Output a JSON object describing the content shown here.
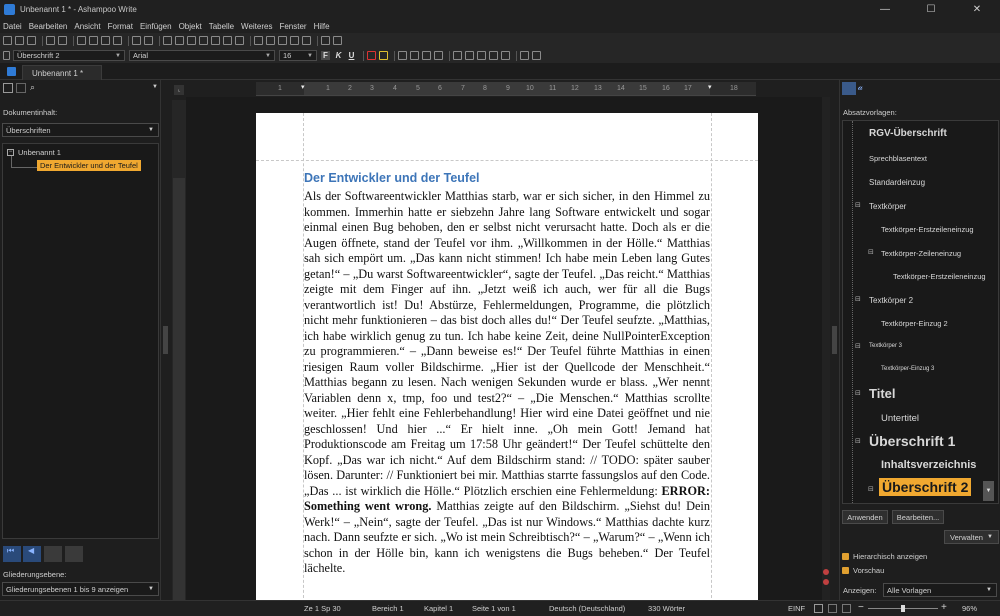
{
  "window": {
    "title": "Unbenannt 1 * - Ashampoo Write"
  },
  "menu": [
    "Datei",
    "Bearbeiten",
    "Ansicht",
    "Format",
    "Einfügen",
    "Objekt",
    "Tabelle",
    "Weiteres",
    "Fenster",
    "Hilfe"
  ],
  "format_toolbar": {
    "paragraph_style": "Überschrift 2",
    "font": "Arial",
    "font_size": "16",
    "bold": "F",
    "italic": "K",
    "underline": "U"
  },
  "tabs": {
    "document_tab": "Unbenannt 1 *"
  },
  "navigator": {
    "content_label": "Dokumentinhalt:",
    "content_select": "Überschriften",
    "tree_root": "Unbenannt 1",
    "tree_child": "Der Entwickler und der Teufel",
    "level_label": "Gliederungsebene:",
    "level_select": "Gliederungsebenen 1 bis 9 anzeigen"
  },
  "ruler": {
    "marks": [
      "1",
      "1",
      "2",
      "3",
      "4",
      "5",
      "6",
      "7",
      "8",
      "9",
      "10",
      "11",
      "12",
      "13",
      "14",
      "15",
      "16",
      "17",
      "18"
    ]
  },
  "document": {
    "heading": "Der Entwickler und der Teufel",
    "body_part1": "Als der Softwareentwickler Matthias starb, war er sich sicher, in den Himmel zu kommen. Immerhin hatte er siebzehn Jahre lang Software entwickelt und sogar einmal einen Bug behoben, den er selbst nicht verursacht hatte. Doch als er die Augen öffnete, stand der Teufel vor ihm. „Willkommen in der Hölle.“ Matthias sah sich empört um. „Das kann nicht stimmen! Ich habe mein Leben lang Gutes getan!“ – „Du warst Softwareentwickler“, sagte der Teufel. „Das reicht.“ Matthias zeigte mit dem Finger auf ihn. „Jetzt weiß ich auch, wer für all die Bugs verantwortlich ist! Du! Abstürze, Fehlermeldungen, Programme, die plötzlich nicht mehr funktionieren – das bist doch alles du!“ Der Teufel seufzte. „Matthias, ich habe wirklich genug zu tun. Ich habe keine Zeit, deine NullPointerException zu programmieren.“ – „Dann beweise es!“ Der Teufel führte Matthias in einen riesigen Raum voller Bildschirme. „Hier ist der Quellcode der Menschheit.“ Matthias begann zu lesen. Nach wenigen Sekunden wurde er blass. „Wer nennt Variablen denn x, tmp, foo und test2?“ – „Die Menschen.“ Matthias scrollte weiter. „Hier fehlt eine Fehlerbehandlung! Hier wird eine Datei geöffnet und nie geschlossen! Und hier ...“ Er hielt inne. „Oh mein Gott! Jemand hat Produktionscode am Freitag um 17:58 Uhr geändert!“ Der Teufel schüttelte den Kopf. „Das war ich nicht.“ Auf dem Bildschirm stand: // TODO: später sauber lösen. Darunter: // Funktioniert bei mir. Matthias starrte fassungslos auf den Code. „Das ... ist wirklich die Hölle.“ Plötzlich erschien eine Fehlermeldung: ",
    "body_bold": "ERROR: Something went wrong.",
    "body_part2": " Matthias zeigte auf den Bildschirm. „Siehst du! Dein Werk!“ – „Nein“, sagte der Teufel. „Das ist nur Windows.“ Matthias dachte kurz nach. Dann seufzte er sich. „Wo ist mein Schreibtisch?“ – „Warum?“ – „Wenn ich schon in der Hölle bin, kann ich wenigstens die Bugs beheben.“ Der Teufel lächelte."
  },
  "styles_panel": {
    "title": "Absatzvorlagen:",
    "items": [
      "RGV-Überschrift",
      "Sprechblasentext",
      "Standardeinzug",
      "Textkörper",
      "Textkörper-Erstzeileneinzug",
      "Textkörper-Zeileneinzug",
      "Textkörper-Erstzeileneinzug",
      "Textkörper 2",
      "Textkörper-Einzug 2",
      "Textkörper 3",
      "Textkörper-Einzug 3",
      "Titel",
      "Untertitel",
      "Überschrift 1",
      "Inhaltsverzeichnis",
      "Überschrift 2"
    ],
    "apply_button": "Anwenden",
    "edit_button": "Bearbeiten...",
    "manage_button": "Verwalten",
    "hierarchical_label": "Hierarchisch anzeigen",
    "preview_label": "Vorschau",
    "show_label": "Anzeigen:",
    "show_select": "Alle Vorlagen"
  },
  "status": {
    "position": "Ze 1 Sp 30",
    "area": "Bereich 1",
    "chapter": "Kapitel 1",
    "page": "Seite 1 von 1",
    "language": "Deutsch (Deutschland)",
    "words": "330 Wörter",
    "mode": "EINF",
    "zoom": "96%"
  },
  "colors": {
    "accent": "#f0a830",
    "heading": "#3d75b8",
    "background": "#1f1f1f"
  }
}
